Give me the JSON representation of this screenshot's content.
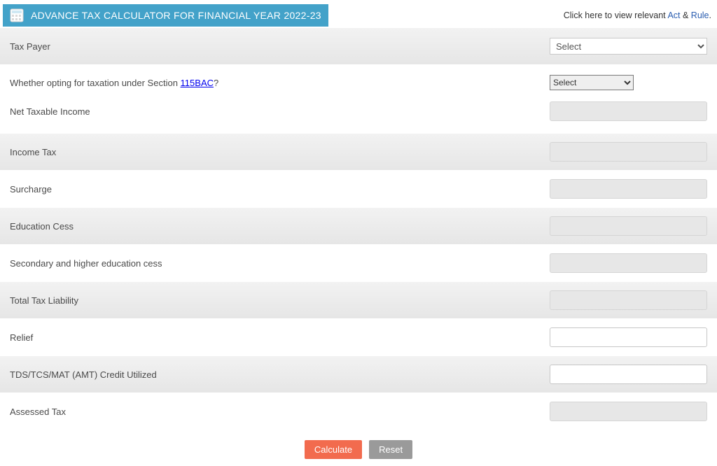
{
  "header": {
    "title": "ADVANCE TAX CALCULATOR FOR FINANCIAL YEAR 2022-23",
    "relevant_prefix": "Click here to view relevant ",
    "act_link": "Act",
    "amp": " & ",
    "rule_link": "Rule",
    "period": "."
  },
  "taxpayer": {
    "label": "Tax Payer",
    "select_placeholder": "Select"
  },
  "section115": {
    "label_prefix": "Whether opting for taxation under Section ",
    "link_text": "115BAC",
    "label_suffix": "?",
    "select_placeholder": "Select"
  },
  "rows": {
    "net_taxable_income": "Net Taxable Income",
    "income_tax": "Income Tax",
    "surcharge": "Surcharge",
    "education_cess": "Education Cess",
    "secondary_cess": "Secondary and higher education cess",
    "total_tax_liability": "Total Tax Liability",
    "relief": "Relief",
    "tds_credit": "TDS/TCS/MAT (AMT) Credit Utilized",
    "assessed_tax": "Assessed Tax"
  },
  "actions": {
    "calculate": "Calculate",
    "reset": "Reset"
  }
}
